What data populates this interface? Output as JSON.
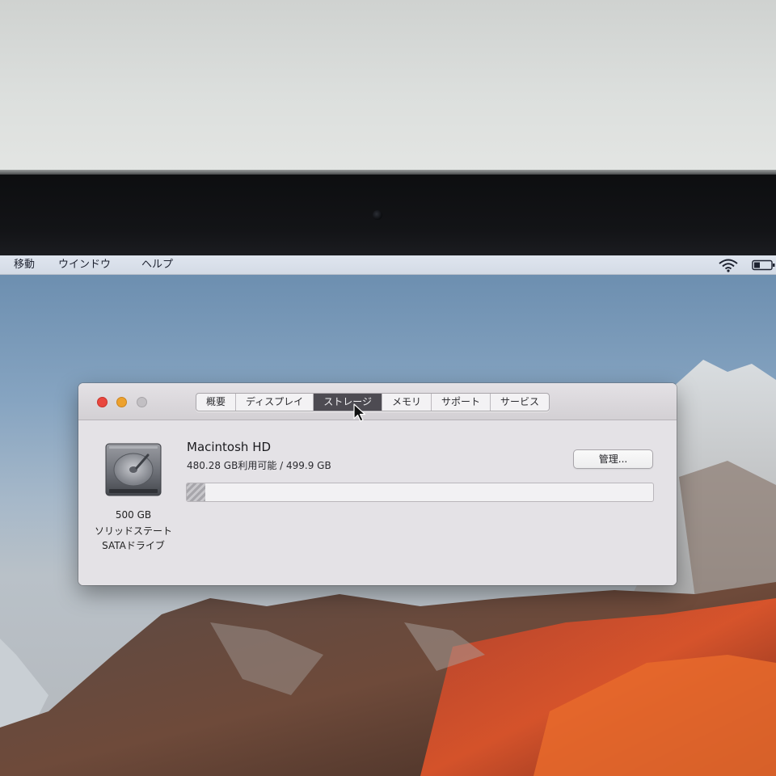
{
  "menubar": {
    "items": [
      {
        "label": "移動"
      },
      {
        "label": "ウインドウ"
      },
      {
        "label": "ヘルプ"
      }
    ],
    "status_icons": [
      "wifi-icon",
      "battery-icon"
    ]
  },
  "window": {
    "traffic_lights": [
      "close",
      "minimize",
      "zoom"
    ],
    "tabs": [
      {
        "label": "概要",
        "active": false
      },
      {
        "label": "ディスプレイ",
        "active": false
      },
      {
        "label": "ストレージ",
        "active": true
      },
      {
        "label": "メモリ",
        "active": false
      },
      {
        "label": "サポート",
        "active": false
      },
      {
        "label": "サービス",
        "active": false
      }
    ],
    "drive": {
      "icon": "hard-drive-icon",
      "capacity": "500 GB",
      "type_line1": "ソリッドステート",
      "type_line2": "SATAドライブ"
    },
    "volume": {
      "name": "Macintosh HD",
      "availability": "480.28 GB利用可能 / 499.9 GB",
      "used_fraction": 0.04
    },
    "manage_button": "管理..."
  },
  "colors": {
    "close": "#e9473f",
    "minimize": "#eda12e",
    "zoom": "#c2bfc3",
    "active_tab": "#4d4b52"
  }
}
